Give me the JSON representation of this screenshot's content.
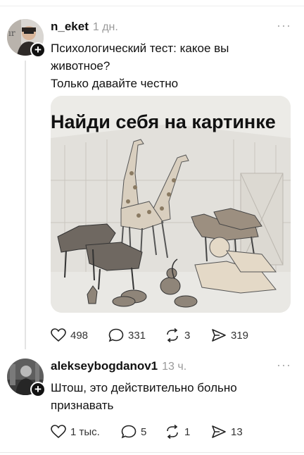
{
  "post1": {
    "username": "n_eket",
    "time": "1 дн.",
    "more": "···",
    "text_line1": "Психологический тест: какое вы",
    "text_line2": "животное?",
    "text_line3": "Только давайте честно",
    "image_caption": "Найди себя на картинке",
    "likes": "498",
    "comments": "331",
    "reposts": "3",
    "shares": "319"
  },
  "post2": {
    "username": "alekseybogdanov1",
    "time": "13 ч.",
    "more": "···",
    "text_line1": "Штош, это действительно больно",
    "text_line2": "признавать",
    "likes": "1 тыс.",
    "comments": "5",
    "reposts": "1",
    "shares": "13"
  },
  "icons": {
    "like": "heart-icon",
    "comment": "comment-icon",
    "repost": "repost-icon",
    "share": "send-icon",
    "follow": "plus-icon"
  }
}
